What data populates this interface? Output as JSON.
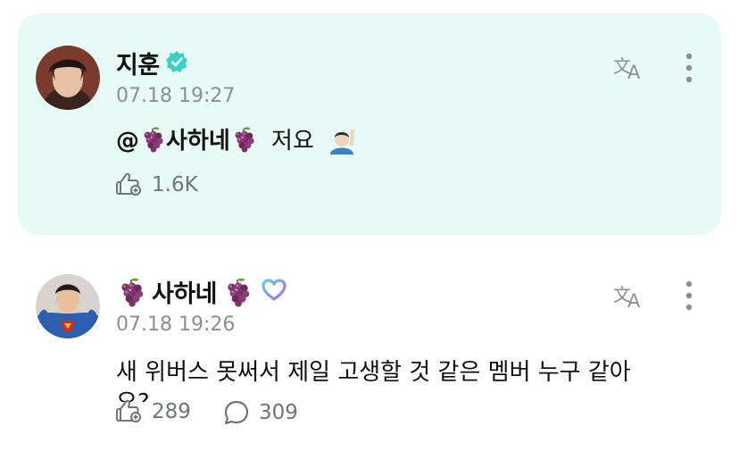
{
  "posts": [
    {
      "author": "지훈",
      "timestamp": "07.18 19:27",
      "mention_text": "@",
      "mention_name": "사하네",
      "body_text": "저요",
      "reaction_count": "1.6K",
      "icons": [
        "verified-check-icon",
        "translate-icon",
        "more-vertical-icon",
        "like-icon",
        "raising-hand-emoji"
      ]
    },
    {
      "author": "사하네",
      "timestamp": "07.18 19:26",
      "body_line1": "새 위버스 못써서 제일 고생할 것 같은 멤버 누구 같아",
      "body_line2": "요?",
      "reaction_count": "289",
      "comment_count": "309",
      "icons": [
        "grape-emoji",
        "membership-heart-icon",
        "translate-icon",
        "more-vertical-icon",
        "like-icon",
        "comment-icon"
      ]
    }
  ],
  "colors": {
    "highlight_bg": "#e8faf6",
    "verified": "#3ad0c4",
    "membership_heart": "#8a7cf0",
    "muted": "#8b8f95",
    "grape": "#6b2a5a"
  }
}
